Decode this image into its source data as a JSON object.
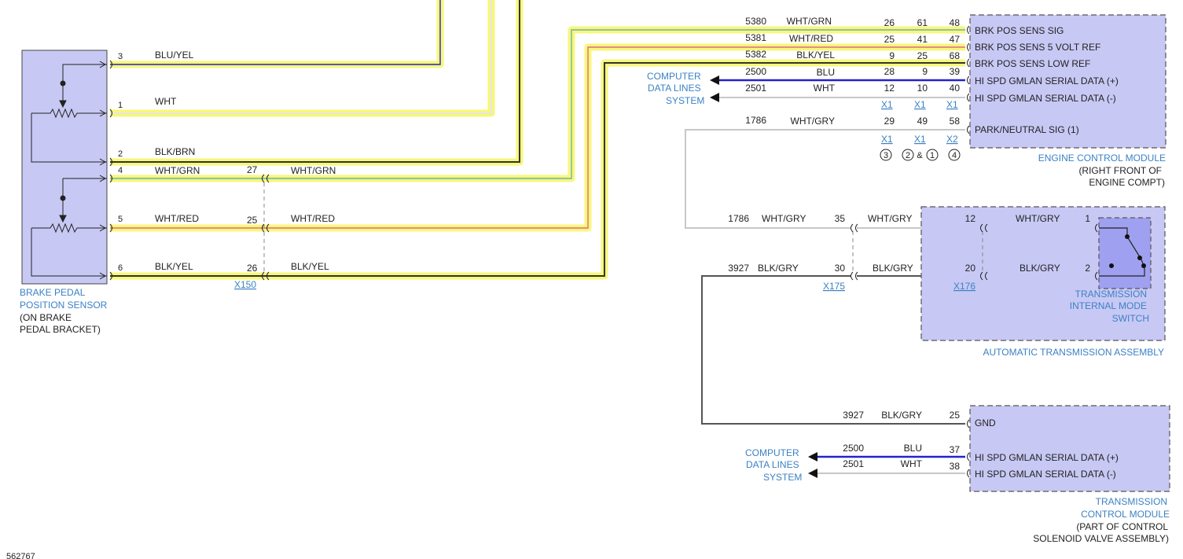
{
  "figure_id": "562767",
  "brake_sensor": {
    "name_line1": "BRAKE PEDAL",
    "name_line2": "POSITION SENSOR",
    "loc_line1": "(ON BRAKE",
    "loc_line2": "PEDAL BRACKET)",
    "pins": [
      {
        "pin": "3",
        "color": "BLU/YEL"
      },
      {
        "pin": "1",
        "color": "WHT"
      },
      {
        "pin": "2",
        "color": "BLK/BRN"
      },
      {
        "pin": "4",
        "color": "WHT/GRN",
        "inline_pin": "27",
        "color_out": "WHT/GRN"
      },
      {
        "pin": "5",
        "color": "WHT/RED",
        "inline_pin": "25",
        "color_out": "WHT/RED"
      },
      {
        "pin": "6",
        "color": "BLK/YEL",
        "inline_pin": "26",
        "color_out": "BLK/YEL"
      }
    ],
    "connector": "X150"
  },
  "ecm": {
    "name": "ENGINE CONTROL MODULE",
    "loc_line1": "(RIGHT FRONT OF",
    "loc_line2": "ENGINE COMPT)",
    "rows": [
      {
        "circuit": "5380",
        "color": "WHT/GRN",
        "p1": "26",
        "p2": "61",
        "p3": "48",
        "label": "BRK POS SENS SIG"
      },
      {
        "circuit": "5381",
        "color": "WHT/RED",
        "p1": "25",
        "p2": "41",
        "p3": "47",
        "label": "BRK POS SENS 5 VOLT REF"
      },
      {
        "circuit": "5382",
        "color": "BLK/YEL",
        "p1": "9",
        "p2": "25",
        "p3": "68",
        "label": "BRK POS SENS LOW REF"
      },
      {
        "circuit": "2500",
        "color": "BLU",
        "p1": "28",
        "p2": "9",
        "p3": "39",
        "label": "HI SPD GMLAN SERIAL DATA (+)"
      },
      {
        "circuit": "2501",
        "color": "WHT",
        "p1": "12",
        "p2": "10",
        "p3": "40",
        "label": "HI SPD GMLAN SERIAL DATA (-)"
      },
      {
        "circuit": "1786",
        "color": "WHT/GRY",
        "p1": "29",
        "p2": "49",
        "p3": "58",
        "label": "PARK/NEUTRAL SIG (1)"
      }
    ],
    "conn_row1": [
      "X1",
      "X1",
      "X1"
    ],
    "conn_row2": [
      "X1",
      "X1",
      "X2"
    ],
    "notes": {
      "a": "3",
      "b": "2",
      "amp": "&",
      "c": "1",
      "d": "4"
    },
    "data_lines": {
      "line1": "COMPUTER",
      "line2": "DATA LINES",
      "line3": "SYSTEM"
    }
  },
  "trans": {
    "row1": {
      "circuit": "1786",
      "color": "WHT/GRY",
      "x175_pin": "35",
      "color_mid": "WHT/GRY",
      "x176_pin": "12",
      "color_in": "WHT/GRY",
      "switch_pin": "1"
    },
    "row2": {
      "circuit": "3927",
      "color": "BLK/GRY",
      "x175_pin": "30",
      "color_mid": "BLK/GRY",
      "x176_pin": "20",
      "color_in": "BLK/GRY",
      "switch_pin": "2"
    },
    "conn_x175": "X175",
    "conn_x176": "X176",
    "switch_line1": "TRANSMISSION",
    "switch_line2": "INTERNAL MODE",
    "switch_line3": "SWITCH",
    "assembly": "AUTOMATIC TRANSMISSION ASSEMBLY"
  },
  "tcm": {
    "rows": [
      {
        "circuit": "3927",
        "color": "BLK/GRY",
        "pin": "25",
        "label": "GND"
      },
      {
        "circuit": "2500",
        "color": "BLU",
        "pin": "37",
        "label": "HI SPD GMLAN SERIAL DATA (+)"
      },
      {
        "circuit": "2501",
        "color": "WHT",
        "pin": "38",
        "label": "HI SPD GMLAN SERIAL DATA (-)"
      }
    ],
    "data_lines": {
      "line1": "COMPUTER",
      "line2": "DATA LINES",
      "line3": "SYSTEM"
    },
    "name_line1": "TRANSMISSION",
    "name_line2": "CONTROL MODULE",
    "loc_line1": "(PART OF CONTROL",
    "loc_line2": "SOLENOID VALVE ASSEMBLY)"
  },
  "colors": {
    "highlight": "#f7f77a",
    "module_fill": "#c8c8f5",
    "switch_fill": "#a0a0f0",
    "label_blue": "#3b82c4",
    "wire_blu": "#2222cc",
    "wire_grey": "#c8c8c8",
    "wire_dark": "#555555"
  }
}
